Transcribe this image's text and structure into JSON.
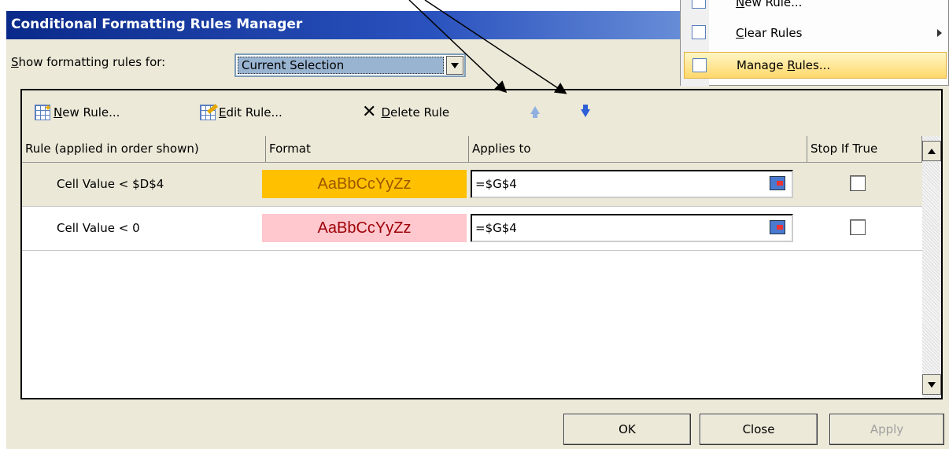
{
  "dialog": {
    "title": "Conditional Formatting Rules Manager",
    "show_label_key": "S",
    "show_label_rest": "how formatting rules for:",
    "selection_value": "Current Selection"
  },
  "toolbar": {
    "new_rule_key": "N",
    "new_rule_rest": "ew Rule...",
    "edit_rule_key": "E",
    "edit_rule_rest": "dit Rule...",
    "delete_rule_key": "D",
    "delete_rule_rest": "elete Rule"
  },
  "table": {
    "headers": [
      "Rule (applied in order shown)",
      "Format",
      "Applies to",
      "Stop If True"
    ],
    "rows": [
      {
        "rule": "Cell Value < $D$4",
        "preview": "AaBbCcYyZz",
        "applies_to": "=$G$4",
        "preview_bg": "#ffc000",
        "preview_fg": "#9c5700"
      },
      {
        "rule": "Cell Value < 0",
        "preview": "AaBbCcYyZz",
        "applies_to": "=$G$4",
        "preview_bg": "#ffc7ce",
        "preview_fg": "#9c0006"
      }
    ]
  },
  "buttons": {
    "ok": "OK",
    "close": "Close",
    "apply": "Apply"
  },
  "menu": {
    "items": [
      {
        "key": "N",
        "rest": "ew Rule..."
      },
      {
        "key": "C",
        "rest": "lear Rules"
      },
      {
        "pre": "Manage ",
        "key": "R",
        "rest": "ules..."
      }
    ]
  }
}
